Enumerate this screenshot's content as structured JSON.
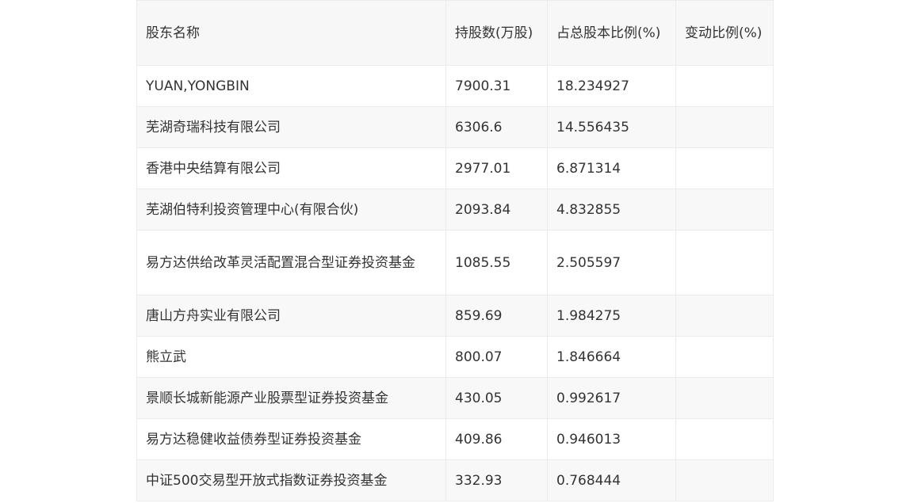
{
  "table": {
    "headers": [
      "股东名称",
      "持股数(万股)",
      "占总股本比例(%)",
      "变动比例(%)"
    ],
    "rows": [
      {
        "name": "YUAN,YONGBIN",
        "shares": "7900.31",
        "ratio": "18.234927",
        "change": ""
      },
      {
        "name": "芜湖奇瑞科技有限公司",
        "shares": "6306.6",
        "ratio": "14.556435",
        "change": ""
      },
      {
        "name": "香港中央结算有限公司",
        "shares": "2977.01",
        "ratio": "6.871314",
        "change": ""
      },
      {
        "name": "芜湖伯特利投资管理中心(有限合伙)",
        "shares": "2093.84",
        "ratio": "4.832855",
        "change": ""
      },
      {
        "name": "易方达供给改革灵活配置混合型证券投资基金",
        "shares": "1085.55",
        "ratio": "2.505597",
        "change": ""
      },
      {
        "name": "唐山方舟实业有限公司",
        "shares": "859.69",
        "ratio": "1.984275",
        "change": ""
      },
      {
        "name": "熊立武",
        "shares": "800.07",
        "ratio": "1.846664",
        "change": ""
      },
      {
        "name": "景顺长城新能源产业股票型证券投资基金",
        "shares": "430.05",
        "ratio": "0.992617",
        "change": ""
      },
      {
        "name": "易方达稳健收益债券型证券投资基金",
        "shares": "409.86",
        "ratio": "0.946013",
        "change": ""
      },
      {
        "name": "中证500交易型开放式指数证券投资基金",
        "shares": "332.93",
        "ratio": "0.768444",
        "change": ""
      }
    ]
  }
}
